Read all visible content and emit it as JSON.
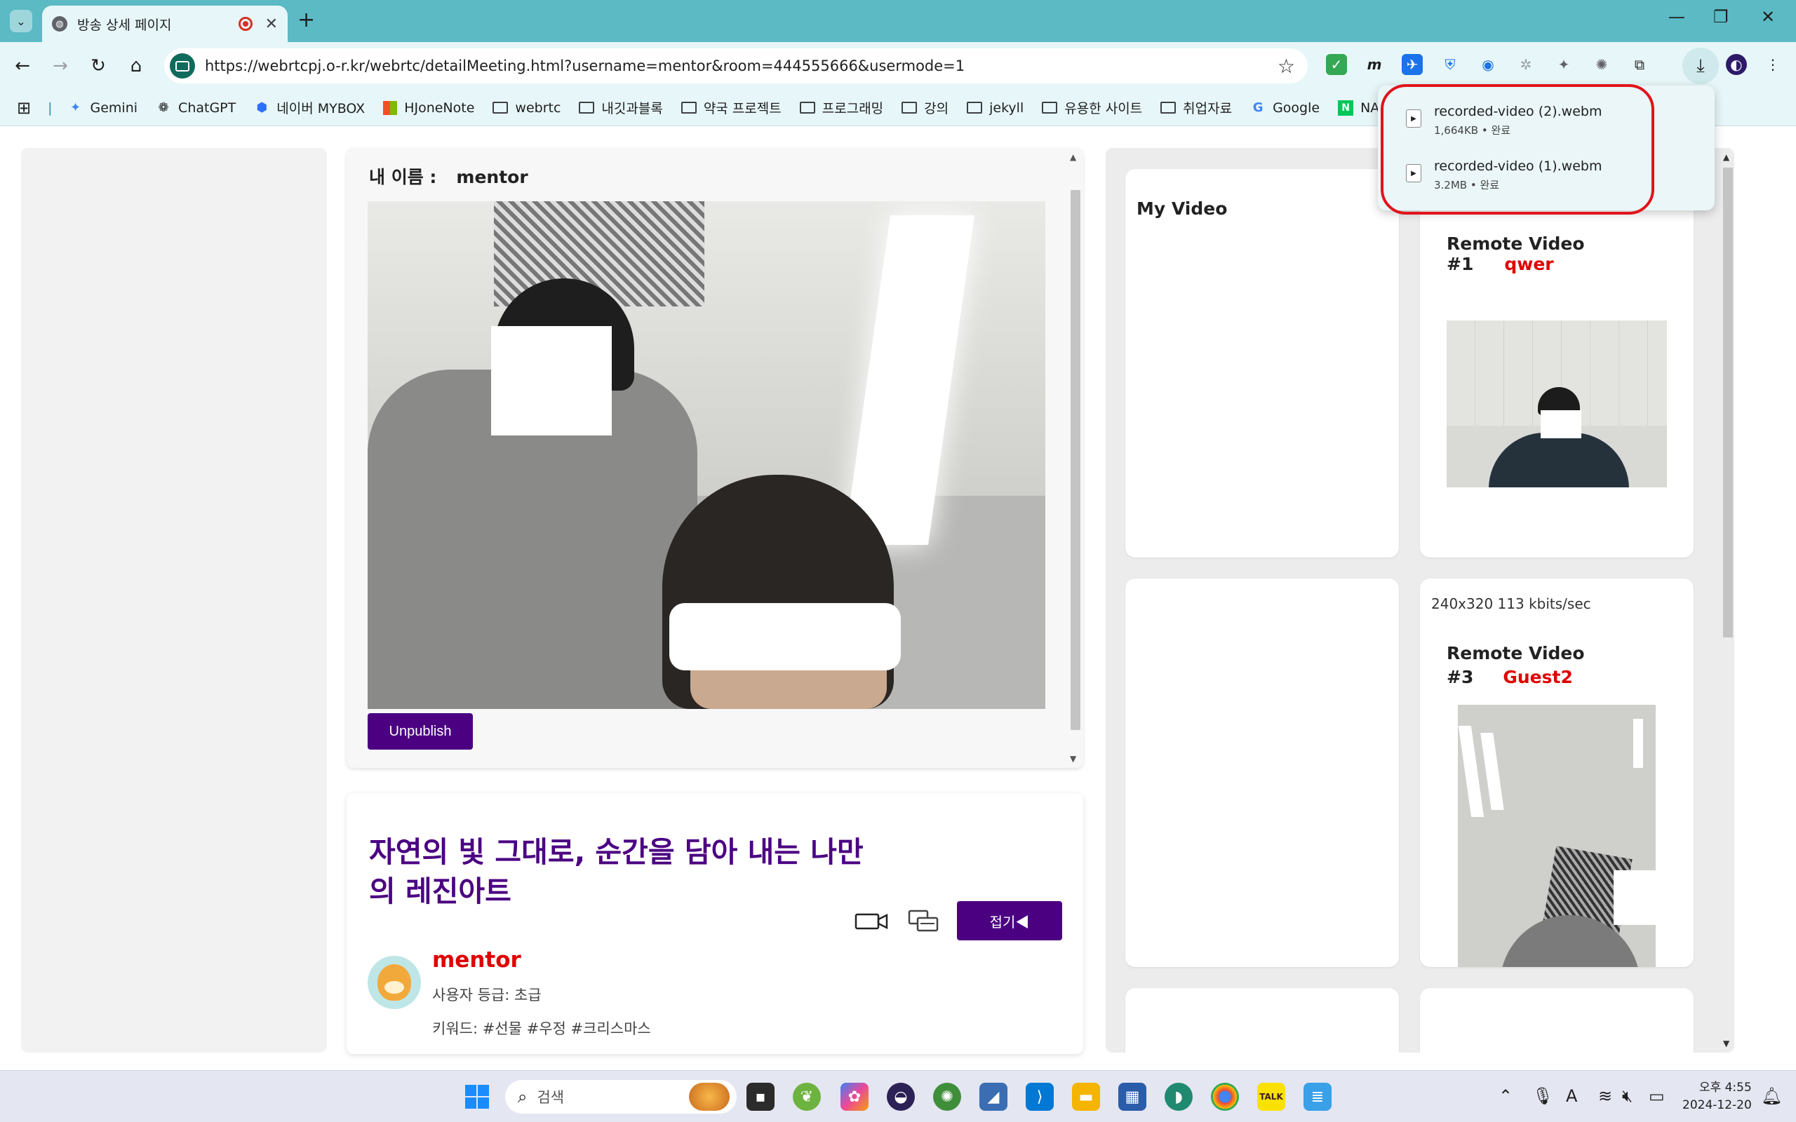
{
  "browser": {
    "tab_title": "방송 상세 페이지",
    "url": "https://webrtcpj.o-r.kr/webrtc/detailMeeting.html?username=mentor&room=444555666&usermode=1",
    "bookmarks": [
      "Gemini",
      "ChatGPT",
      "네이버 MYBOX",
      "HJoneNote",
      "webrtc",
      "내깃과블록",
      "약국 프로젝트",
      "프로그래밍",
      "강의",
      "jekyll",
      "유용한 사이트",
      "취업자료",
      "Google",
      "NA"
    ]
  },
  "downloads": {
    "items": [
      {
        "name": "recorded-video (2).webm",
        "meta": "1,664KB • 완료"
      },
      {
        "name": "recorded-video (1).webm",
        "meta": "3.2MB • 완료"
      }
    ]
  },
  "broadcast": {
    "name_label": "내 이름 :",
    "name_value": "mentor",
    "unpublish_label": "Unpublish",
    "title": "자연의 빛 그대로, 순간을 담아 내는 나만의 레진아트",
    "fold_label": "접기◀",
    "host_name": "mentor",
    "grade": "사용자 등급: 초급",
    "keywords": "키워드: #선물 #우정 #크리스마스"
  },
  "remote": {
    "my_video_label": "My Video",
    "rv1_label": "Remote Video #1",
    "rv1_user": "qwer",
    "stats": "240x320   113 kbits/sec",
    "rv3_label_line1": "Remote Video",
    "rv3_label_line2": "#3",
    "rv3_user": "Guest2"
  },
  "taskbar": {
    "search_placeholder": "검색",
    "time": "오후 4:55",
    "date": "2024-12-20"
  },
  "colors": {
    "accent": "#4b0082",
    "user_red": "#e00000",
    "chrome_tab": "#5bbac4",
    "highlight": "#e0141c"
  }
}
